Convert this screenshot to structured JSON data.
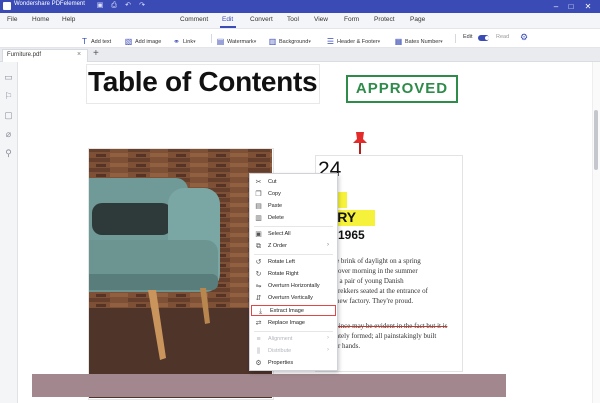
{
  "app": {
    "title": "Wondershare PDFelement",
    "accent_color": "#3a4bb5",
    "quick_access_icons": [
      "save-icon",
      "print-icon",
      "undo-icon",
      "redo-icon"
    ],
    "window_controls": [
      "minimize-icon",
      "maximize-icon",
      "close-icon"
    ]
  },
  "menu": {
    "left_items": [
      "File",
      "Home",
      "Help"
    ],
    "tabs": [
      "Comment",
      "Edit",
      "Convert",
      "Tool",
      "View",
      "Form",
      "Protect",
      "Page"
    ],
    "active_tab": "Edit"
  },
  "toolbar": {
    "items": [
      {
        "label": "Add text",
        "icon": "add-text-icon"
      },
      {
        "label": "Add image",
        "icon": "add-image-icon"
      },
      {
        "label": "Link",
        "icon": "link-icon"
      },
      {
        "label": "Watermark",
        "icon": "watermark-icon"
      },
      {
        "label": "Background",
        "icon": "background-icon"
      },
      {
        "label": "Header & Footer",
        "icon": "header-footer-icon"
      },
      {
        "label": "Bates Number",
        "icon": "bates-number-icon"
      }
    ],
    "mode_edit": "Edit",
    "mode_read": "Read"
  },
  "tabs": {
    "document": "Furniture.pdf"
  },
  "sidebar_icons": [
    "thumbnails-icon",
    "bookmark-icon",
    "comment-icon",
    "attachment-icon",
    "search-icon"
  ],
  "document": {
    "heading": "Table of Contents",
    "stamp": "APPROVED",
    "stamp_color": "#2e8b4a",
    "number": "24",
    "line_r": "R",
    "line_story": "TORY",
    "line_since": "CE 1965",
    "paragraph": [
      "e brink of daylight on a spring",
      "lover morning in the summer",
      ", a pair of young Danish",
      "trekkers seated at the entrance of",
      "new factory. They're proud."
    ],
    "paragraph_struck": "since may be evident in the fact but it is",
    "paragraph_end": [
      "ately formed; all painstakingly built",
      "ir hands."
    ]
  },
  "context_menu": {
    "items": [
      {
        "label": "Cut",
        "icon": "scissors-icon",
        "disabled": false
      },
      {
        "label": "Copy",
        "icon": "copy-icon",
        "disabled": false
      },
      {
        "label": "Paste",
        "icon": "paste-icon",
        "disabled": false
      },
      {
        "label": "Delete",
        "icon": "trash-icon",
        "disabled": false
      },
      {
        "label": "Select All",
        "icon": "select-all-icon",
        "disabled": false
      },
      {
        "label": "Z Order",
        "icon": "z-order-icon",
        "disabled": false,
        "submenu": true
      },
      {
        "label": "Rotate Left",
        "icon": "rotate-left-icon",
        "disabled": false
      },
      {
        "label": "Rotate Right",
        "icon": "rotate-right-icon",
        "disabled": false
      },
      {
        "label": "Overturn Horizontally",
        "icon": "flip-horizontal-icon",
        "disabled": false
      },
      {
        "label": "Overturn Vertically",
        "icon": "flip-vertical-icon",
        "disabled": false
      },
      {
        "label": "Extract Image",
        "icon": "extract-image-icon",
        "disabled": false,
        "highlighted": true
      },
      {
        "label": "Replace Image",
        "icon": "replace-image-icon",
        "disabled": false
      },
      {
        "label": "Alignment",
        "icon": "alignment-icon",
        "disabled": true,
        "submenu": true
      },
      {
        "label": "Distribute",
        "icon": "distribute-icon",
        "disabled": true,
        "submenu": true
      },
      {
        "label": "Properties",
        "icon": "properties-icon",
        "disabled": false
      }
    ]
  }
}
